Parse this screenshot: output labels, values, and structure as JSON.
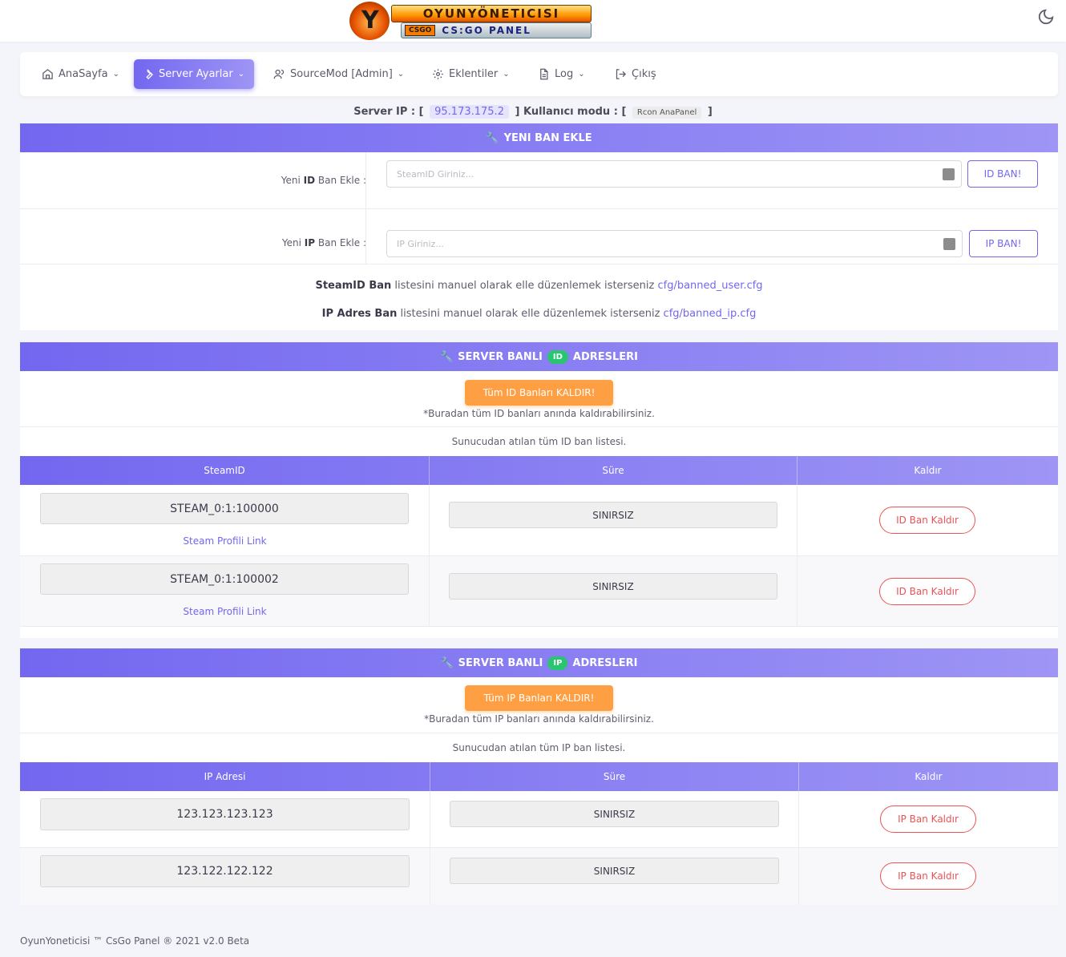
{
  "header": {
    "logo_title": "OYUNYÖNETICISI",
    "logo_badge": "CSGO",
    "logo_subtitle": "CS:GO PANEL",
    "theme_icon": "moon-icon"
  },
  "nav": {
    "items": [
      {
        "label": "AnaSayfa",
        "icon": "home-icon"
      },
      {
        "label": "Server Ayarlar",
        "icon": "wrench-icon",
        "active": true
      },
      {
        "label": "SourceMod [Admin]",
        "icon": "users-icon"
      },
      {
        "label": "Eklentiler",
        "icon": "gear-icon"
      },
      {
        "label": "Log",
        "icon": "file-icon"
      },
      {
        "label": "Çıkış",
        "icon": "logout-icon"
      }
    ]
  },
  "server": {
    "ip_label": "Server IP : [",
    "ip": "95.173.175.2",
    "mode_label": "] Kullanıcı modu : [",
    "mode": "Rcon AnaPanel",
    "close": "]"
  },
  "new_ban": {
    "title": "YENI BAN EKLE",
    "id_label_pre": "Yeni",
    "id_label_bold": "ID",
    "id_label_post": "Ban Ekle :",
    "id_placeholder": "SteamID Giriniz...",
    "id_button": "ID BAN!",
    "ip_label_pre": "Yeni",
    "ip_label_bold": "IP",
    "ip_label_post": "Ban Ekle :",
    "ip_placeholder": "IP Giriniz...",
    "ip_button": "IP BAN!",
    "note1_bold": "SteamID Ban",
    "note1_text": "listesini manuel olarak elle düzenlemek isterseniz",
    "note1_link": "cfg/banned_user.cfg",
    "note2_bold": "IP Adres Ban",
    "note2_text": "listesini manuel olarak elle düzenlemek isterseniz",
    "note2_link": "cfg/banned_ip.cfg"
  },
  "id_bans": {
    "title_pre": "SERVER BANLI",
    "pill": "ID",
    "title_post": "ADRESLERI",
    "remove_all": "Tüm ID Banları KALDIR!",
    "remove_note": "*Buradan tüm ID banları anında kaldırabilirsiniz.",
    "list_caption": "Sunucudan atılan tüm ID ban listesi.",
    "columns": [
      "SteamID",
      "Süre",
      "Kaldır"
    ],
    "rows": [
      {
        "id": "STEAM_0:1:100000",
        "link": "Steam Profili Link",
        "duration": "SINIRSIZ",
        "action": "ID Ban Kaldır"
      },
      {
        "id": "STEAM_0:1:100002",
        "link": "Steam Profili Link",
        "duration": "SINIRSIZ",
        "action": "ID Ban Kaldır"
      }
    ]
  },
  "ip_bans": {
    "title_pre": "SERVER BANLI",
    "pill": "IP",
    "title_post": "ADRESLERI",
    "remove_all": "Tüm IP Banları KALDIR!",
    "remove_note": "*Buradan tüm IP banları anında kaldırabilirsiniz.",
    "list_caption": "Sunucudan atılan tüm IP ban listesi.",
    "columns": [
      "IP Adresi",
      "Süre",
      "Kaldır"
    ],
    "rows": [
      {
        "ip": "123.123.123.123",
        "duration": "SINIRSIZ",
        "action": "IP Ban Kaldır"
      },
      {
        "ip": "123.122.122.122",
        "duration": "SINIRSIZ",
        "action": "IP Ban Kaldır"
      }
    ]
  },
  "footer": "OyunYoneticisi ™ CsGo Panel ® 2021 v2.0 Beta"
}
